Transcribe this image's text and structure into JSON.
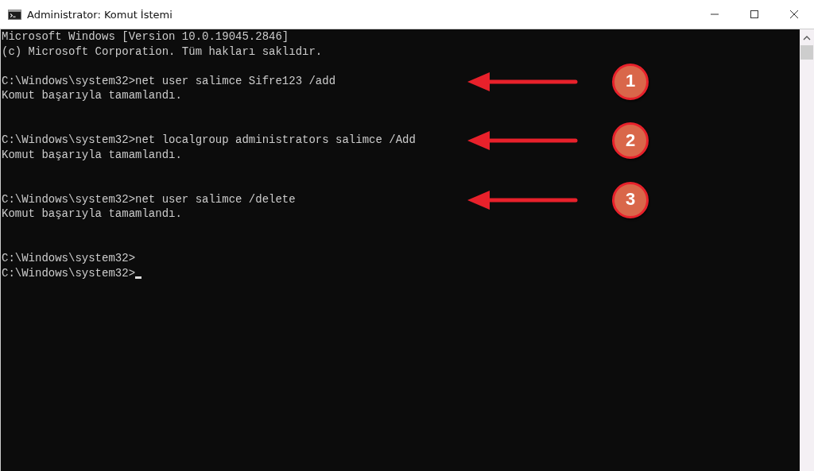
{
  "window": {
    "title": "Administrator: Komut İstemi"
  },
  "console": {
    "blocks": [
      {
        "lines": [
          "Microsoft Windows [Version 10.0.19045.2846]",
          "(c) Microsoft Corporation. Tüm hakları saklıdır."
        ]
      },
      {
        "lines": [
          "C:\\Windows\\system32>net user salimce Sifre123 /add",
          "Komut başarıyla tamamlandı."
        ],
        "marker": "1"
      },
      {
        "lines": [
          "C:\\Windows\\system32>net localgroup administrators salimce /Add",
          "Komut başarıyla tamamlandı."
        ],
        "marker": "2"
      },
      {
        "lines": [
          "C:\\Windows\\system32>net user salimce /delete",
          "Komut başarıyla tamamlandı."
        ],
        "marker": "3"
      },
      {
        "lines": [
          "C:\\Windows\\system32>",
          "C:\\Windows\\system32>"
        ],
        "cursor": true
      }
    ]
  }
}
